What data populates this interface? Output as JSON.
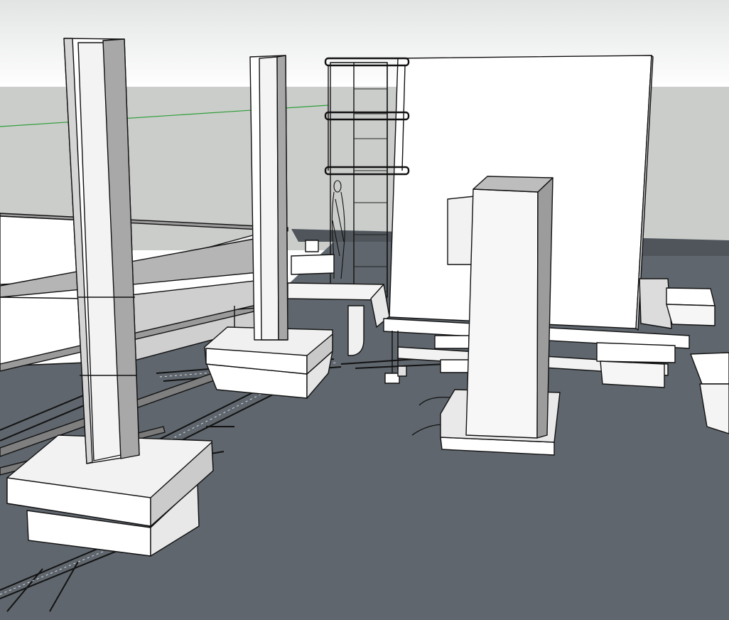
{
  "viewport": {
    "tool": "orbit",
    "colors": {
      "sky_top": "#e2e4e4",
      "sky_bottom": "#ffffff",
      "horizon_band": "#cbcdca",
      "ground": "#5f666d",
      "ground_dark": "#4f555b",
      "face_light": "#ffffff",
      "face_mid": "#e6e6e6",
      "face_shade": "#b9b9b9",
      "face_dark": "#8d8d8d",
      "edge": "#111111",
      "green_axis": "#2e9e3a"
    }
  }
}
